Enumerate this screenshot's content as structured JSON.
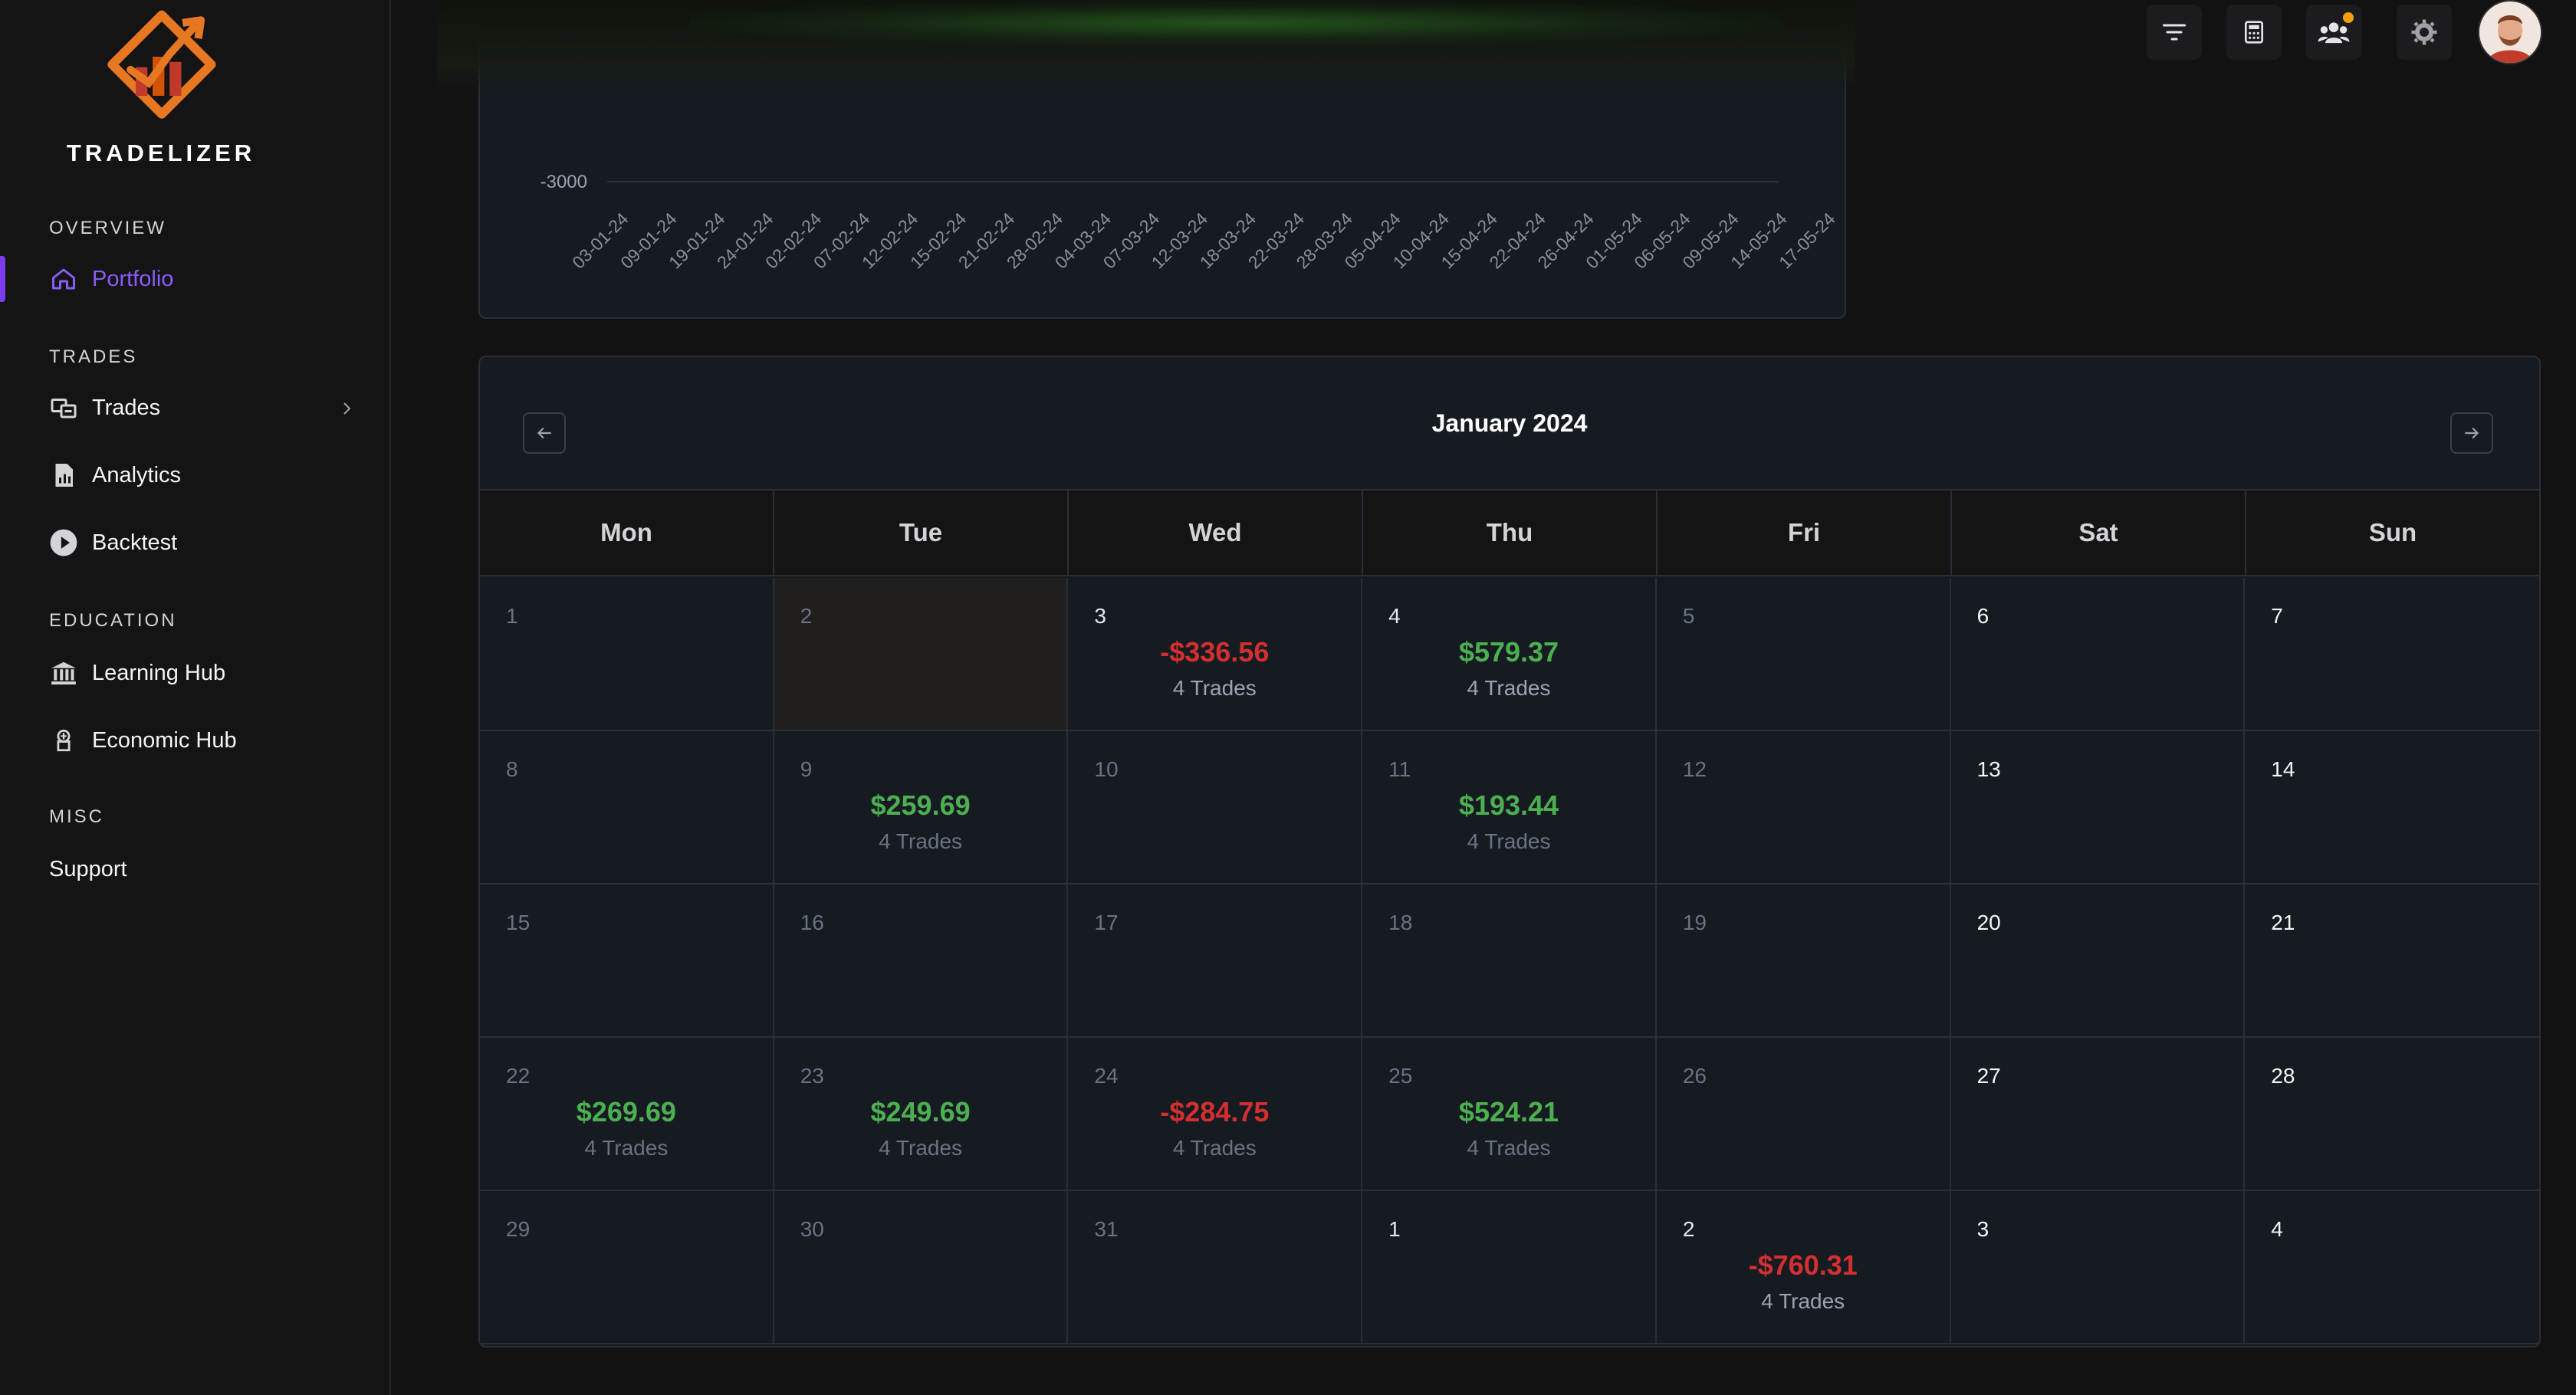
{
  "brand": {
    "name": "TRADELIZER"
  },
  "colors": {
    "accent": "#7c3aed",
    "positive": "#4caf50",
    "negative": "#d32f2f",
    "brand_orange": "#e87722"
  },
  "sidebar": {
    "sections": [
      {
        "title": "OVERVIEW"
      },
      {
        "title": "TRADES"
      },
      {
        "title": "EDUCATION"
      },
      {
        "title": "MISC"
      }
    ],
    "items": [
      {
        "label": "Portfolio",
        "icon": "home-icon",
        "active": true
      },
      {
        "label": "Trades",
        "icon": "trades-icon",
        "has_submenu": true
      },
      {
        "label": "Analytics",
        "icon": "analytics-icon"
      },
      {
        "label": "Backtest",
        "icon": "play-icon"
      },
      {
        "label": "Learning Hub",
        "icon": "bank-icon"
      },
      {
        "label": "Economic Hub",
        "icon": "economic-icon"
      },
      {
        "label": "Support",
        "icon": ""
      }
    ]
  },
  "topbar": {
    "buttons": [
      "filter-icon",
      "calculator-icon",
      "users-icon",
      "settings-icon"
    ],
    "notification": true
  },
  "chart": {
    "y_tick": "-3000",
    "x_ticks": [
      "03-01-24",
      "09-01-24",
      "19-01-24",
      "24-01-24",
      "02-02-24",
      "07-02-24",
      "12-02-24",
      "15-02-24",
      "21-02-24",
      "28-02-24",
      "04-03-24",
      "07-03-24",
      "12-03-24",
      "18-03-24",
      "22-03-24",
      "28-03-24",
      "05-04-24",
      "10-04-24",
      "15-04-24",
      "22-04-24",
      "26-04-24",
      "01-05-24",
      "06-05-24",
      "09-05-24",
      "14-05-24",
      "17-05-24"
    ]
  },
  "calendar": {
    "title": "January 2024",
    "weekdays": [
      "Mon",
      "Tue",
      "Wed",
      "Thu",
      "Fri",
      "Sat",
      "Sun"
    ],
    "days": [
      {
        "d": "1",
        "m": "prev"
      },
      {
        "d": "2",
        "m": "prev",
        "hl": true
      },
      {
        "d": "3",
        "m": "cur",
        "amount": "-$336.56",
        "trades": "4 Trades",
        "neg": true
      },
      {
        "d": "4",
        "m": "cur",
        "amount": "$579.37",
        "trades": "4 Trades"
      },
      {
        "d": "5",
        "m": "prev"
      },
      {
        "d": "6",
        "m": "wk"
      },
      {
        "d": "7",
        "m": "wk"
      },
      {
        "d": "8",
        "m": "prev"
      },
      {
        "d": "9",
        "m": "prev",
        "amount": "$259.69",
        "trades": "4 Trades"
      },
      {
        "d": "10",
        "m": "prev"
      },
      {
        "d": "11",
        "m": "prev",
        "amount": "$193.44",
        "trades": "4 Trades"
      },
      {
        "d": "12",
        "m": "prev"
      },
      {
        "d": "13",
        "m": "wk"
      },
      {
        "d": "14",
        "m": "wk"
      },
      {
        "d": "15",
        "m": "prev"
      },
      {
        "d": "16",
        "m": "prev"
      },
      {
        "d": "17",
        "m": "prev"
      },
      {
        "d": "18",
        "m": "prev"
      },
      {
        "d": "19",
        "m": "prev"
      },
      {
        "d": "20",
        "m": "wk"
      },
      {
        "d": "21",
        "m": "wk"
      },
      {
        "d": "22",
        "m": "prev",
        "amount": "$269.69",
        "trades": "4 Trades"
      },
      {
        "d": "23",
        "m": "prev",
        "amount": "$249.69",
        "trades": "4 Trades"
      },
      {
        "d": "24",
        "m": "prev",
        "amount": "-$284.75",
        "trades": "4 Trades",
        "neg": true
      },
      {
        "d": "25",
        "m": "prev",
        "amount": "$524.21",
        "trades": "4 Trades"
      },
      {
        "d": "26",
        "m": "prev"
      },
      {
        "d": "27",
        "m": "wk"
      },
      {
        "d": "28",
        "m": "wk"
      },
      {
        "d": "29",
        "m": "prev"
      },
      {
        "d": "30",
        "m": "prev"
      },
      {
        "d": "31",
        "m": "prev"
      },
      {
        "d": "1",
        "m": "cur"
      },
      {
        "d": "2",
        "m": "cur",
        "amount": "-$760.31",
        "trades": "4 Trades",
        "neg": true
      },
      {
        "d": "3",
        "m": "wk"
      },
      {
        "d": "4",
        "m": "wk"
      }
    ]
  }
}
